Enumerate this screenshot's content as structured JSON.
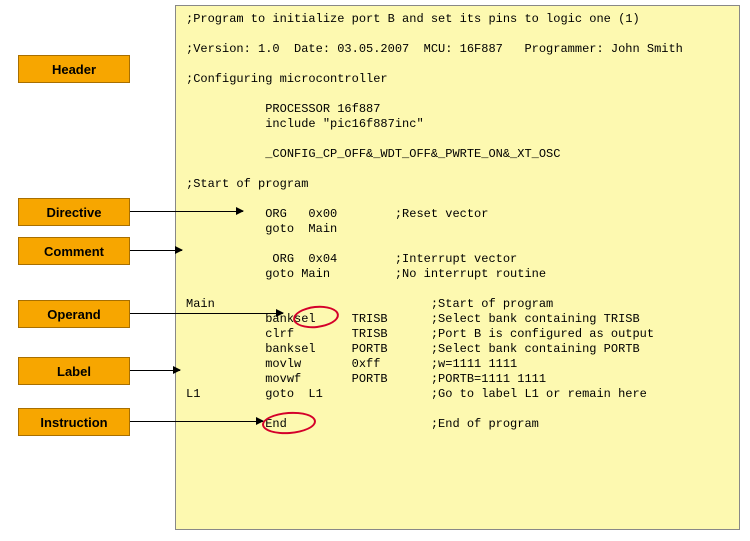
{
  "labels": {
    "header": "Header",
    "directive": "Directive",
    "comment": "Comment",
    "operand": "Operand",
    "label": "Label",
    "instruction": "Instruction"
  },
  "code": {
    "l1": ";Program to initialize port B and set its pins to logic one (1)",
    "l2": "",
    "l3": ";Version: 1.0  Date: 03.05.2007  MCU: 16F887   Programmer: John Smith",
    "l4": "",
    "l5": ";Configuring microcontroller",
    "l6": "",
    "l7": "           PROCESSOR 16f887",
    "l8": "           include \"pic16f887inc\"",
    "l9": "",
    "l10": "           _CONFIG_CP_OFF&_WDT_OFF&_PWRTE_ON&_XT_OSC",
    "l11": "",
    "l12": ";Start of program",
    "l13": "",
    "l14": "           ORG   0x00        ;Reset vector",
    "l15": "           goto  Main",
    "l16": "",
    "l17": "            ORG  0x04        ;Interrupt vector",
    "l18": "           goto Main         ;No interrupt routine",
    "l19": "",
    "l20": "Main                              ;Start of program",
    "l21": "           banksel     TRISB      ;Select bank containing TRISB",
    "l22": "           clrf        TRISB      ;Port B is configured as output",
    "l23": "           banksel     PORTB      ;Select bank containing PORTB",
    "l24": "           movlw       0xff       ;w=1111 1111",
    "l25": "           movwf       PORTB      ;PORTB=1111 1111",
    "l26": "L1         goto  L1               ;Go to label L1 or remain here",
    "l27": "",
    "l28": "           End                    ;End of program"
  }
}
